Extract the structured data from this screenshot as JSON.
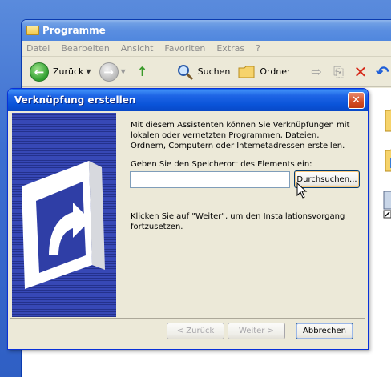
{
  "explorer": {
    "title": "Programme",
    "menu": [
      "Datei",
      "Bearbeiten",
      "Ansicht",
      "Favoriten",
      "Extras",
      "?"
    ],
    "toolbar": {
      "back_label": "Zurück",
      "search_label": "Suchen",
      "folders_label": "Ordner"
    }
  },
  "dialog": {
    "title": "Verknüpfung erstellen",
    "close_glyph": "✕",
    "intro_text": "Mit diesem Assistenten können Sie Verknüpfungen mit lokalen oder vernetzten Programmen, Dateien, Ordnern, Computern oder Internetadressen erstellen.",
    "location_prompt": "Geben Sie den Speicherort des Elements ein:",
    "location_value": "",
    "browse_label": "Durchsuchen...",
    "finish_text": "Klicken Sie auf \"Weiter\", um den Installationsvorgang fortzusetzen.",
    "buttons": {
      "back": "< Zurück",
      "next": "Weiter >",
      "cancel": "Abbrechen"
    }
  },
  "colors": {
    "wizard_panel": "#2f3ea6",
    "titlebar": "#0a54d9",
    "close_button": "#d24b22"
  }
}
